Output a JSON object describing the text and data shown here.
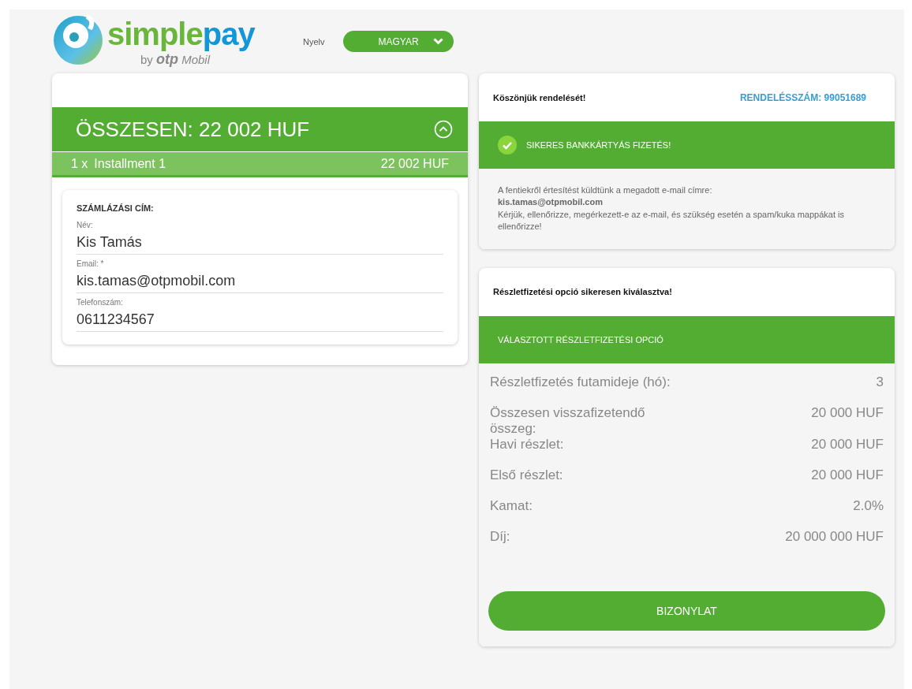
{
  "logo": {
    "word_1": "simple",
    "word_2": "pay",
    "by": "by",
    "brand": "otp",
    "brand_2": "Mobil"
  },
  "language": {
    "label": "Nyelv",
    "value": "MAGYAR"
  },
  "summary": {
    "total": "ÖSSZESEN: 22 002 HUF",
    "expanded": true,
    "items": [
      {
        "qty": "1 x",
        "name": "Installment 1",
        "amount": "22 002 HUF"
      }
    ]
  },
  "billing": {
    "title": "SZÁMLÁZÁSI CÍM:",
    "fields": [
      {
        "label": "Név:",
        "value": "Kis Tamás"
      },
      {
        "label": "Email: *",
        "value": "kis.tamas@otpmobil.com"
      },
      {
        "label": "Telefonszám:",
        "value": "0611234567"
      }
    ]
  },
  "confirmation": {
    "thanks": "Köszönjük rendelését!",
    "order_number": "RENDELÉSSZÁM: 99051689",
    "status": "SIKERES BANKKÁRTYÁS FIZETÉS!",
    "message": "A fentiekről értesítést küldtünk a megadott e-mail címre:\n**kis.tamas@otpmobil.com**\nKérjük, ellenőrizze, megérkezett-e az e-mail, és szükség esetén a spam/kuka mappákat is ellenőrizze!"
  },
  "installment": {
    "notice": "Részletfizetési opció sikeresen kiválasztva!",
    "heading": "VÁLASZTOTT RÉSZLETFIZETÉSI OPCIÓ",
    "rows": [
      {
        "label": "Részletfizetés futamideje (hó):",
        "value": "3"
      },
      {
        "label": "Összesen visszafizetendő összeg:",
        "value": "20 000 HUF"
      },
      {
        "label": "Havi részlet:",
        "value": "20 000 HUF"
      },
      {
        "label": "Első részlet:",
        "value": "20 000 HUF"
      },
      {
        "label": "Kamat:",
        "value": "2.0%"
      },
      {
        "label": "Díj:",
        "value": "20 000 000 HUF"
      }
    ],
    "button": "BIZONYLAT"
  }
}
